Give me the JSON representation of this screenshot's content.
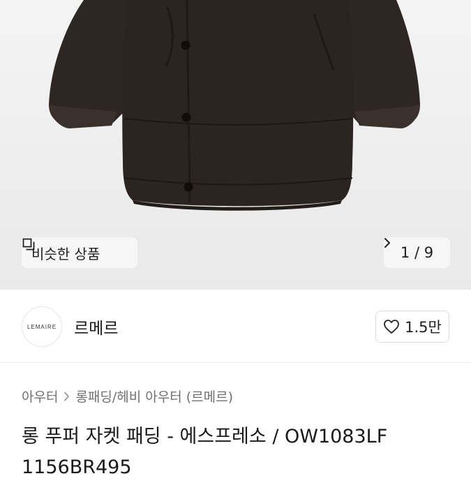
{
  "gallery": {
    "similar_label": "비슷한 상품",
    "page_current": "1",
    "page_separator": "/",
    "page_total": "9",
    "icons": {
      "similar": "stacked-squares-icon",
      "next": "chevron-right-icon"
    }
  },
  "shop": {
    "logo_text": "LEMAIRE",
    "name": "르메르",
    "like_count": "1.5만",
    "like_icon": "heart-outline-icon"
  },
  "breadcrumb": {
    "items": [
      "아우터",
      "롱패딩/헤비 아우터 (르메르)"
    ],
    "separator_icon": "chevron-right-icon"
  },
  "product": {
    "title": "롱 푸퍼 자켓 패딩 - 에스프레소 / OW1083LF 1156BR495"
  },
  "colors": {
    "jacket": "#2e2623",
    "hero_bg": "#eeeeee",
    "chip_bg": "#f6f6f6",
    "text_primary": "#1a1a1a",
    "text_secondary": "#707070"
  }
}
